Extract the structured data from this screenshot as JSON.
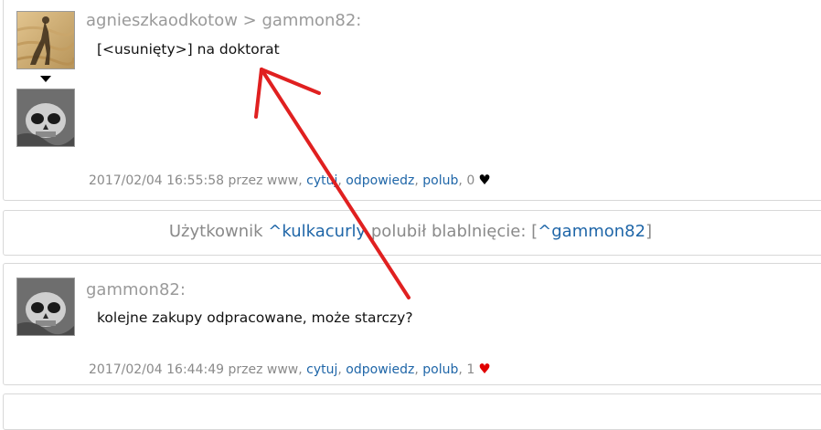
{
  "post1": {
    "header": "agnieszkaodkotow > gammon82:",
    "text": "[<usunięty>] na doktorat",
    "footer": {
      "datetime": "2017/02/04 16:55:58",
      "via": "przez www,",
      "cite": "cytuj",
      "reply": "odpowiedz",
      "like": "polub",
      "count": "0"
    }
  },
  "notification": {
    "prefix": "Użytkownik",
    "user": "^kulkacurly",
    "middle": "polubił blablnięcie:",
    "open": "[",
    "target": "^gammon82",
    "close": "]"
  },
  "post2": {
    "header": "gammon82:",
    "text": "kolejne zakupy odpracowane, może starczy?",
    "footer": {
      "datetime": "2017/02/04 16:44:49",
      "via": "przez www,",
      "cite": "cytuj",
      "reply": "odpowiedz",
      "like": "polub",
      "count": "1"
    }
  },
  "icons": {
    "heart": "♥",
    "heart_black_color": "#000000",
    "heart_red_color": "#e00000",
    "link_color": "#1f66a8",
    "annotation_arrow_color": "#e02020"
  }
}
